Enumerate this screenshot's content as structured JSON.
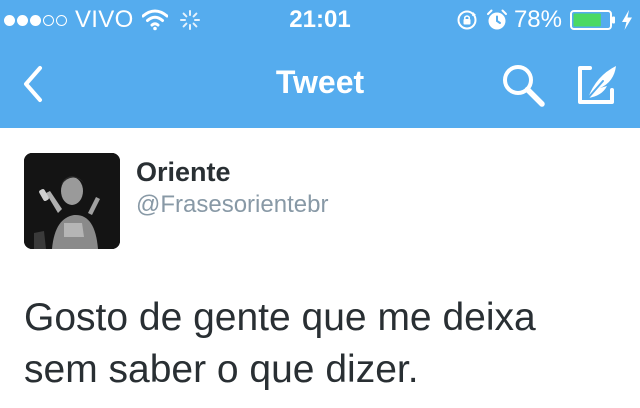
{
  "status_bar": {
    "signal_filled": 3,
    "signal_empty": 2,
    "carrier": "VIVO",
    "time": "21:01",
    "battery_percent": "78%",
    "battery_level": 0.78,
    "icons": [
      "signal-dots-icon",
      "wifi-icon",
      "activity-spinner-icon",
      "rotation-lock-icon",
      "alarm-icon",
      "battery-icon",
      "charging-bolt-icon"
    ]
  },
  "nav": {
    "title": "Tweet",
    "icons": [
      "back-chevron-icon",
      "search-icon",
      "compose-tweet-icon"
    ]
  },
  "tweet": {
    "author_name": "Oriente",
    "author_handle": "@Frasesorientebr",
    "text_lines": [
      "Gosto de gente que me deixa",
      "sem saber o que dizer."
    ]
  },
  "colors": {
    "twitter_blue": "#55acee",
    "text_dark": "#292f33",
    "text_gray": "#8899a6"
  }
}
